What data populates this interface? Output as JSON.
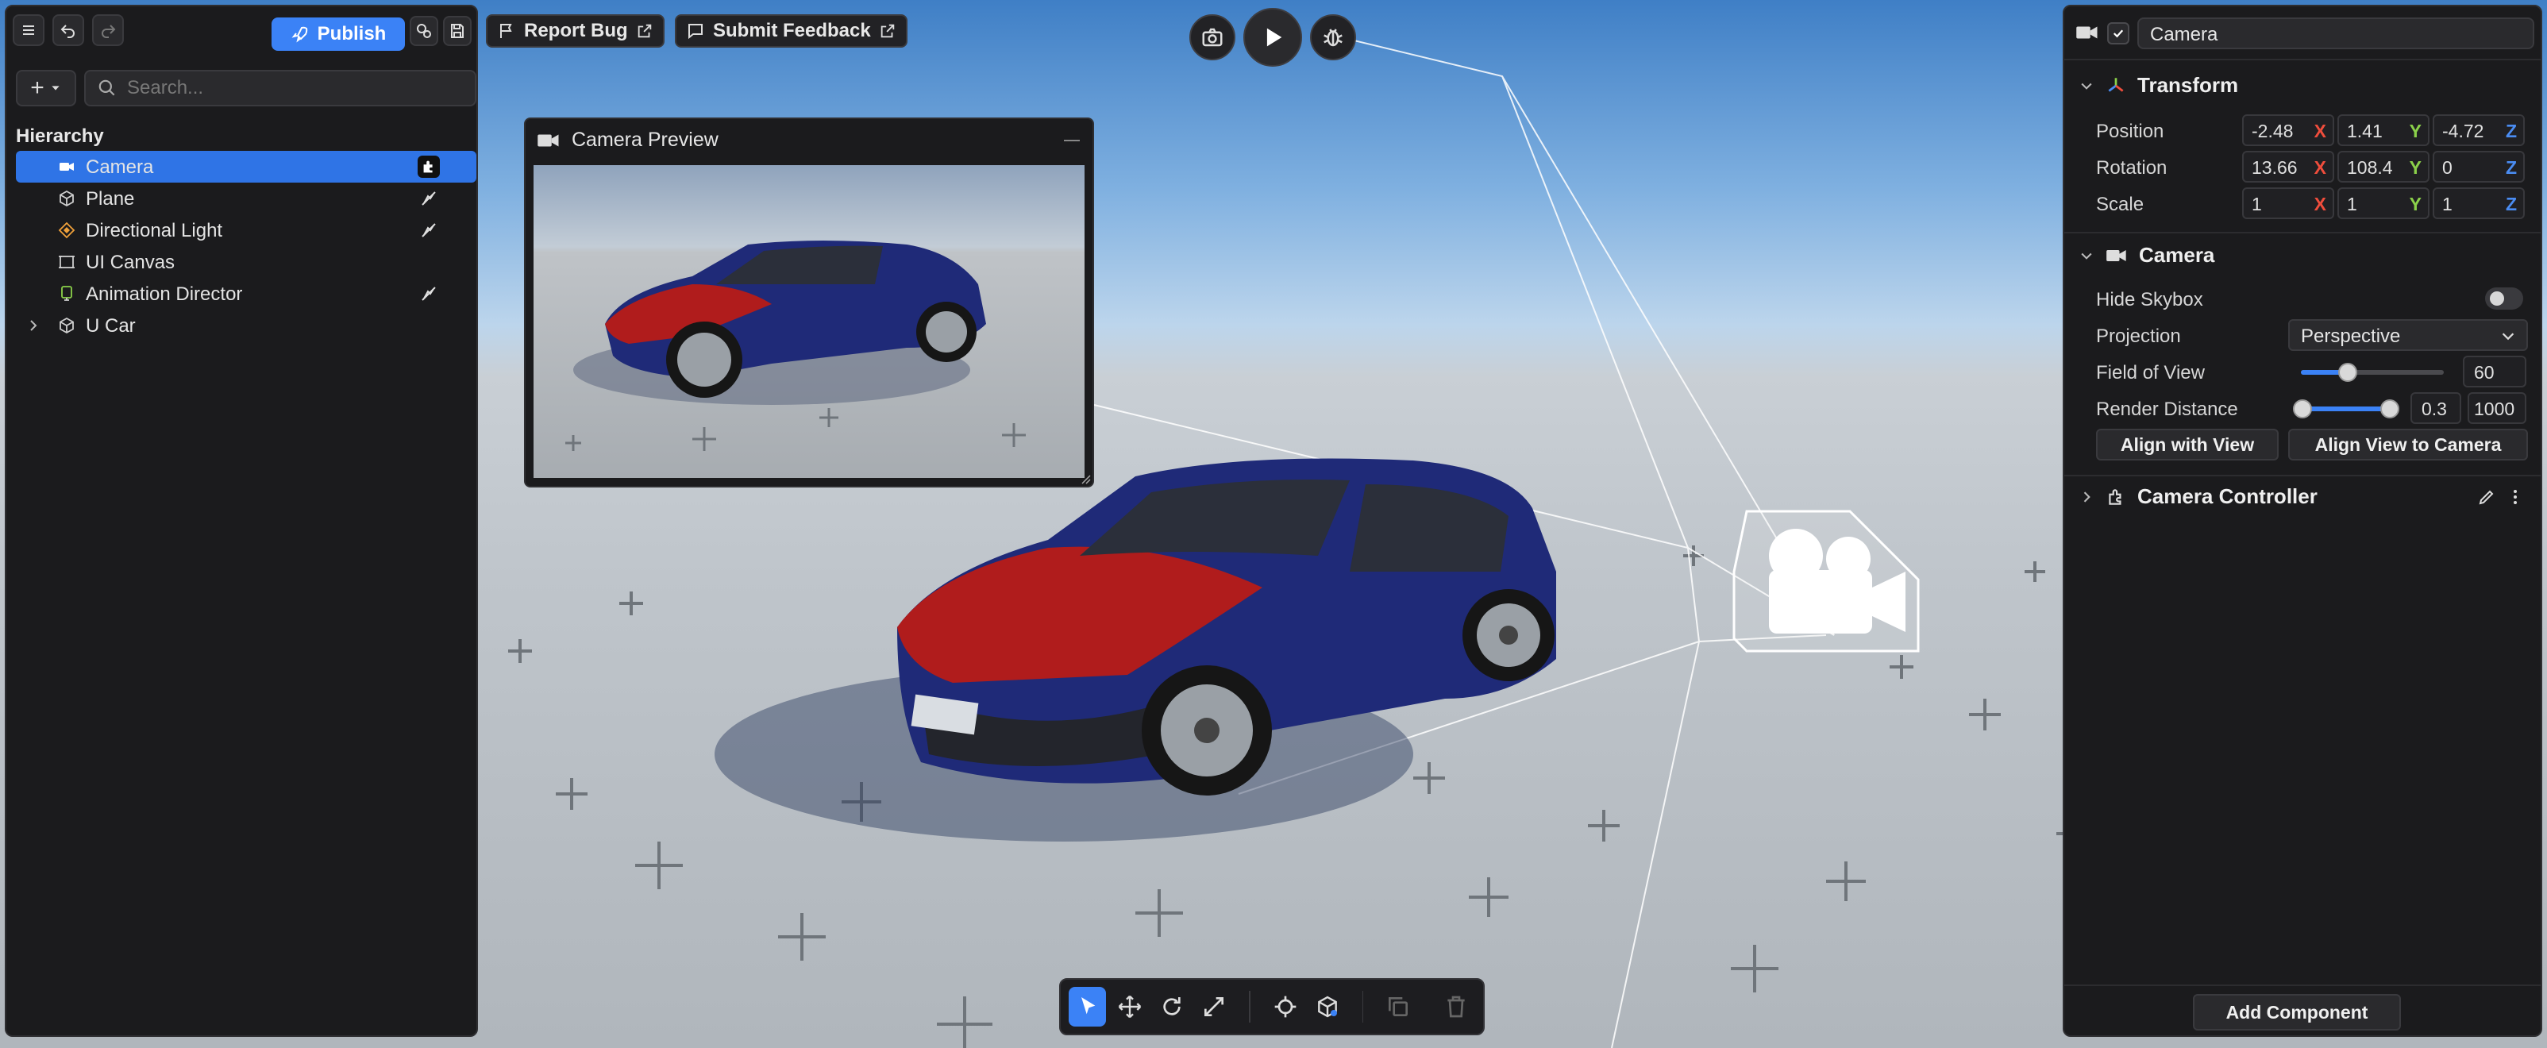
{
  "toolbar": {
    "publish_label": "Publish",
    "report_bug_label": "Report Bug",
    "submit_feedback_label": "Submit Feedback"
  },
  "hierarchy": {
    "title": "Hierarchy",
    "search_placeholder": "Search...",
    "items": [
      {
        "label": "Camera",
        "icon": "video-camera-icon",
        "selected": true
      },
      {
        "label": "Plane",
        "icon": "cube-icon"
      },
      {
        "label": "Directional Light",
        "icon": "light-icon"
      },
      {
        "label": "UI Canvas",
        "icon": "canvas-icon"
      },
      {
        "label": "Animation Director",
        "icon": "director-icon"
      },
      {
        "label": "U Car",
        "icon": "cube-icon",
        "expandable": true
      }
    ]
  },
  "preview": {
    "title": "Camera Preview"
  },
  "inspector": {
    "object_name": "Camera",
    "transform": {
      "title": "Transform",
      "position_label": "Position",
      "rotation_label": "Rotation",
      "scale_label": "Scale",
      "position": {
        "x": "-2.48",
        "y": "1.41",
        "z": "-4.72"
      },
      "rotation": {
        "x": "13.66",
        "y": "108.4",
        "z": "0"
      },
      "scale": {
        "x": "1",
        "y": "1",
        "z": "1"
      },
      "axis_x": "X",
      "axis_y": "Y",
      "axis_z": "Z"
    },
    "camera": {
      "title": "Camera",
      "hide_skybox_label": "Hide Skybox",
      "hide_skybox_on": false,
      "projection_label": "Projection",
      "projection_value": "Perspective",
      "fov_label": "Field of View",
      "fov_value": "60",
      "fov_fraction": 0.33,
      "render_distance_label": "Render Distance",
      "render_near": "0.3",
      "render_far": "1000",
      "align_with_view_label": "Align with View",
      "align_view_to_camera_label": "Align View to Camera"
    },
    "camera_controller": {
      "title": "Camera Controller"
    },
    "add_component_label": "Add Component"
  },
  "colors": {
    "accent": "#3b82f6",
    "axis_x": "#ef4d3c",
    "axis_y": "#8bd14a",
    "axis_z": "#4a8cf2",
    "car_body": "#1f2a78",
    "car_hood": "#b01c1c"
  }
}
